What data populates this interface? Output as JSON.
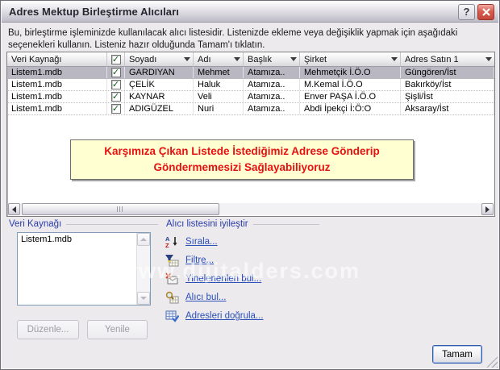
{
  "window": {
    "title": "Adres Mektup Birleştirme Alıcıları",
    "help_label": "?"
  },
  "description": {
    "text": "Bu, birleştirme işleminizde kullanılacak alıcı listesidir. Listenizde ekleme veya değişiklik yapmak için aşağıdaki seçenekleri kullanın. Listeniz hazır olduğunda Tamam'ı tıklatın."
  },
  "icons": {
    "checkmark": "✓"
  },
  "table": {
    "columns": [
      {
        "label": "Veri Kaynağı"
      },
      {
        "label": ""
      },
      {
        "label": "Soyadı"
      },
      {
        "label": "Adı"
      },
      {
        "label": "Başlık"
      },
      {
        "label": "Şirket"
      },
      {
        "label": "Adres Satın 1"
      }
    ],
    "rows": [
      {
        "source": "Listem1.mdb",
        "checked": true,
        "soyadi": "GARDIYAN",
        "adi": "Mehmet",
        "baslik": "Atamıza..",
        "sirket": "Mehmetçik İ.Ö.O",
        "adres": "Güngören/İst",
        "selected": true
      },
      {
        "source": "Listem1.mdb",
        "checked": true,
        "soyadi": "ÇELİK",
        "adi": "Haluk",
        "baslik": "Atamıza..",
        "sirket": "M.Kemal İ.Ö.O",
        "adres": "Bakırköy/İst",
        "selected": false
      },
      {
        "source": "Listem1.mdb",
        "checked": true,
        "soyadi": "KAYNAR",
        "adi": "Veli",
        "baslik": "Atamıza..",
        "sirket": "Enver PAŞA İ.Ö.O",
        "adres": "Şişli/İst",
        "selected": false
      },
      {
        "source": "Listem1.mdb",
        "checked": true,
        "soyadi": "ADIGÜZEL",
        "adi": "Nuri",
        "baslik": "Atamıza..",
        "sirket": "Abdi İpekçi İ:Ö:O",
        "adres": "Aksaray/İst",
        "selected": false
      }
    ]
  },
  "callout": {
    "text": "Karşımıza Çıkan Listede İstediğimiz Adrese Gönderip Göndermemesizi Sağlayabiliyoruz",
    "bg_color": "#FFFFD2",
    "text_color": "#E61212"
  },
  "data_source": {
    "label": "Veri Kaynağı",
    "items": [
      "Listem1.mdb"
    ],
    "edit_label": "Düzenle...",
    "refresh_label": "Yenile"
  },
  "refine": {
    "label": "Alıcı listesini iyileştir",
    "links": [
      {
        "icon": "sort-az-icon",
        "label": "Sırala..."
      },
      {
        "icon": "filter-icon",
        "label": "Filtre..."
      },
      {
        "icon": "find-duplicates-icon",
        "label": "Yinelenenleri bul..."
      },
      {
        "icon": "find-recipient-icon",
        "label": "Alıcı bul..."
      },
      {
        "icon": "validate-addresses-icon",
        "label": "Adresleri doğrula..."
      }
    ]
  },
  "footer": {
    "ok_label": "Tamam"
  },
  "watermark": {
    "text": "www.dijitalders.com"
  },
  "colors": {
    "link_blue": "#2B50B8",
    "selected_row": "#B9B8C2",
    "dialog_bg": "#ECEAED"
  }
}
